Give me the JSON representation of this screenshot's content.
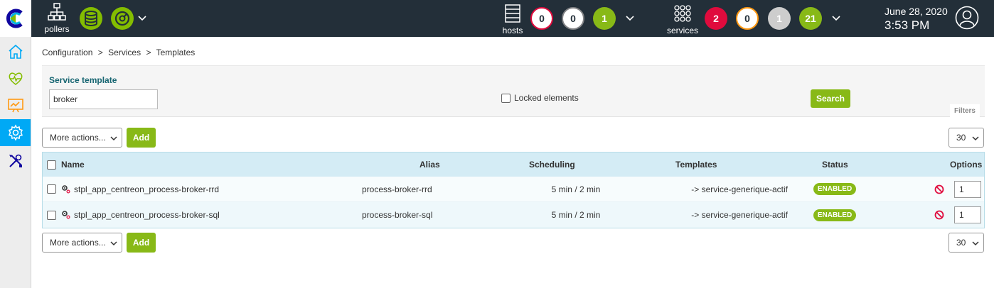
{
  "topbar": {
    "pollers_label": "pollers",
    "hosts_label": "hosts",
    "services_label": "services",
    "hosts_counts": {
      "down": "0",
      "unreachable": "0",
      "up": "1"
    },
    "services_counts": {
      "critical": "2",
      "warning": "0",
      "unknown": "1",
      "ok": "21"
    },
    "date": "June 28, 2020",
    "time": "3:53 PM"
  },
  "breadcrumb": [
    "Configuration",
    ">",
    "Services",
    ">",
    "Templates"
  ],
  "filters": {
    "title": "Service template",
    "search_value": "broker",
    "locked_label": "Locked elements",
    "search_button": "Search",
    "tab_label": "Filters"
  },
  "toolbar": {
    "more_actions": "More actions...",
    "add": "Add",
    "per_page": "30"
  },
  "table": {
    "headers": {
      "name": "Name",
      "alias": "Alias",
      "scheduling": "Scheduling",
      "templates": "Templates",
      "status": "Status",
      "options": "Options"
    },
    "rows": [
      {
        "name": "stpl_app_centreon_process-broker-rrd",
        "alias": "process-broker-rrd",
        "scheduling": "5 min / 2 min",
        "templates": "-> service-generique-actif",
        "status": "ENABLED",
        "option_value": "1"
      },
      {
        "name": "stpl_app_centreon_process-broker-sql",
        "alias": "process-broker-sql",
        "scheduling": "5 min / 2 min",
        "templates": "-> service-generique-actif",
        "status": "ENABLED",
        "option_value": "1"
      }
    ]
  },
  "colors": {
    "topbar_bg": "#232f39",
    "green": "#88b917",
    "active_blue": "#00a9f5",
    "critical_red": "#e00b3d",
    "warning_orange": "#ff9913"
  }
}
